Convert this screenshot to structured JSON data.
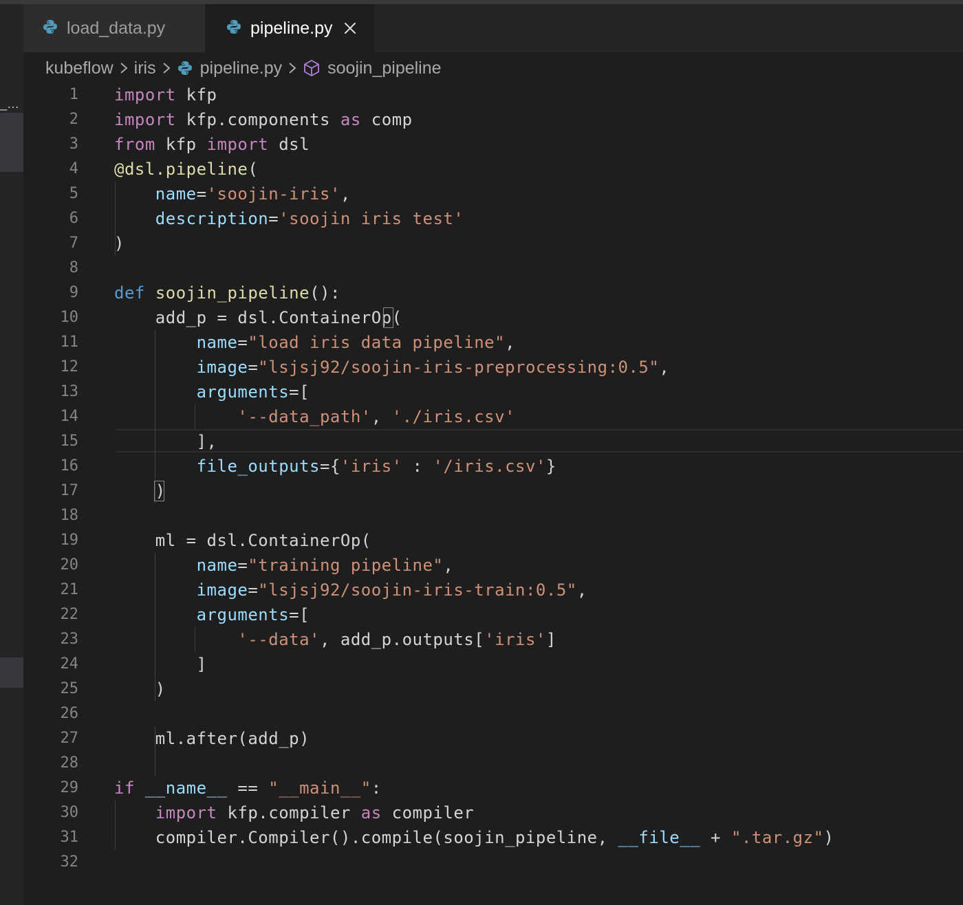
{
  "tabs": [
    {
      "label": "load_data.py",
      "active": false,
      "icon": "python-icon"
    },
    {
      "label": "pipeline.py",
      "active": true,
      "icon": "python-icon"
    }
  ],
  "breadcrumb": {
    "segments": [
      "kubeflow",
      "iris",
      "pipeline.py",
      "soojin_pipeline"
    ]
  },
  "sidebar_fragment_text": "_…",
  "editor": {
    "current_line": 15,
    "lines": [
      {
        "n": "1",
        "tokens": [
          {
            "t": "kw",
            "v": "import"
          },
          {
            "t": "op",
            "v": " kfp"
          }
        ]
      },
      {
        "n": "2",
        "tokens": [
          {
            "t": "kw",
            "v": "import"
          },
          {
            "t": "op",
            "v": " kfp.components "
          },
          {
            "t": "kw",
            "v": "as"
          },
          {
            "t": "op",
            "v": " comp"
          }
        ]
      },
      {
        "n": "3",
        "tokens": [
          {
            "t": "kw",
            "v": "from"
          },
          {
            "t": "op",
            "v": " kfp "
          },
          {
            "t": "kw",
            "v": "import"
          },
          {
            "t": "op",
            "v": " dsl"
          }
        ]
      },
      {
        "n": "4",
        "tokens": [
          {
            "t": "dec",
            "v": "@dsl.pipeline"
          },
          {
            "t": "op",
            "v": "("
          }
        ]
      },
      {
        "n": "5",
        "tokens": [
          {
            "t": "op",
            "v": "    "
          },
          {
            "t": "prm",
            "v": "name"
          },
          {
            "t": "op",
            "v": "="
          },
          {
            "t": "str",
            "v": "'soojin-iris'"
          },
          {
            "t": "op",
            "v": ","
          }
        ]
      },
      {
        "n": "6",
        "tokens": [
          {
            "t": "op",
            "v": "    "
          },
          {
            "t": "prm",
            "v": "description"
          },
          {
            "t": "op",
            "v": "="
          },
          {
            "t": "str",
            "v": "'soojin iris test'"
          }
        ]
      },
      {
        "n": "7",
        "tokens": [
          {
            "t": "op",
            "v": ")"
          }
        ]
      },
      {
        "n": "8",
        "tokens": []
      },
      {
        "n": "9",
        "tokens": [
          {
            "t": "kwb",
            "v": "def"
          },
          {
            "t": "op",
            "v": " "
          },
          {
            "t": "fn",
            "v": "soojin_pipeline"
          },
          {
            "t": "op",
            "v": "():"
          }
        ]
      },
      {
        "n": "10",
        "tokens": [
          {
            "t": "op",
            "v": "    add_p = dsl.ContainerOp("
          }
        ]
      },
      {
        "n": "11",
        "tokens": [
          {
            "t": "op",
            "v": "        "
          },
          {
            "t": "prm",
            "v": "name"
          },
          {
            "t": "op",
            "v": "="
          },
          {
            "t": "str",
            "v": "\"load iris data pipeline\""
          },
          {
            "t": "op",
            "v": ","
          }
        ]
      },
      {
        "n": "12",
        "tokens": [
          {
            "t": "op",
            "v": "        "
          },
          {
            "t": "prm",
            "v": "image"
          },
          {
            "t": "op",
            "v": "="
          },
          {
            "t": "str",
            "v": "\"lsjsj92/soojin-iris-preprocessing:0.5\""
          },
          {
            "t": "op",
            "v": ","
          }
        ]
      },
      {
        "n": "13",
        "tokens": [
          {
            "t": "op",
            "v": "        "
          },
          {
            "t": "prm",
            "v": "arguments"
          },
          {
            "t": "op",
            "v": "=["
          }
        ]
      },
      {
        "n": "14",
        "tokens": [
          {
            "t": "op",
            "v": "            "
          },
          {
            "t": "str",
            "v": "'--data_path'"
          },
          {
            "t": "op",
            "v": ", "
          },
          {
            "t": "str",
            "v": "'./iris.csv'"
          }
        ]
      },
      {
        "n": "15",
        "tokens": [
          {
            "t": "op",
            "v": "        ],"
          }
        ]
      },
      {
        "n": "16",
        "tokens": [
          {
            "t": "op",
            "v": "        "
          },
          {
            "t": "prm",
            "v": "file_outputs"
          },
          {
            "t": "op",
            "v": "={"
          },
          {
            "t": "str",
            "v": "'iris'"
          },
          {
            "t": "op",
            "v": " : "
          },
          {
            "t": "str",
            "v": "'/iris.csv'"
          },
          {
            "t": "op",
            "v": "}"
          }
        ]
      },
      {
        "n": "17",
        "tokens": [
          {
            "t": "op",
            "v": "    )"
          }
        ]
      },
      {
        "n": "18",
        "tokens": []
      },
      {
        "n": "19",
        "tokens": [
          {
            "t": "op",
            "v": "    ml = dsl.ContainerOp("
          }
        ]
      },
      {
        "n": "20",
        "tokens": [
          {
            "t": "op",
            "v": "        "
          },
          {
            "t": "prm",
            "v": "name"
          },
          {
            "t": "op",
            "v": "="
          },
          {
            "t": "str",
            "v": "\"training pipeline\""
          },
          {
            "t": "op",
            "v": ","
          }
        ]
      },
      {
        "n": "21",
        "tokens": [
          {
            "t": "op",
            "v": "        "
          },
          {
            "t": "prm",
            "v": "image"
          },
          {
            "t": "op",
            "v": "="
          },
          {
            "t": "str",
            "v": "\"lsjsj92/soojin-iris-train:0.5\""
          },
          {
            "t": "op",
            "v": ","
          }
        ]
      },
      {
        "n": "22",
        "tokens": [
          {
            "t": "op",
            "v": "        "
          },
          {
            "t": "prm",
            "v": "arguments"
          },
          {
            "t": "op",
            "v": "=["
          }
        ]
      },
      {
        "n": "23",
        "tokens": [
          {
            "t": "op",
            "v": "            "
          },
          {
            "t": "str",
            "v": "'--data'"
          },
          {
            "t": "op",
            "v": ", add_p.outputs["
          },
          {
            "t": "str",
            "v": "'iris'"
          },
          {
            "t": "op",
            "v": "]"
          }
        ]
      },
      {
        "n": "24",
        "tokens": [
          {
            "t": "op",
            "v": "        ]"
          }
        ]
      },
      {
        "n": "25",
        "tokens": [
          {
            "t": "op",
            "v": "    )"
          }
        ]
      },
      {
        "n": "26",
        "tokens": []
      },
      {
        "n": "27",
        "tokens": [
          {
            "t": "op",
            "v": "    ml.after(add_p)"
          }
        ]
      },
      {
        "n": "28",
        "tokens": []
      },
      {
        "n": "29",
        "tokens": [
          {
            "t": "kw",
            "v": "if"
          },
          {
            "t": "op",
            "v": " "
          },
          {
            "t": "prm",
            "v": "__name__"
          },
          {
            "t": "op",
            "v": " == "
          },
          {
            "t": "str",
            "v": "\"__main__\""
          },
          {
            "t": "op",
            "v": ":"
          }
        ]
      },
      {
        "n": "30",
        "tokens": [
          {
            "t": "op",
            "v": "    "
          },
          {
            "t": "kw",
            "v": "import"
          },
          {
            "t": "op",
            "v": " kfp.compiler "
          },
          {
            "t": "kw",
            "v": "as"
          },
          {
            "t": "op",
            "v": " compiler"
          }
        ]
      },
      {
        "n": "31",
        "tokens": [
          {
            "t": "op",
            "v": "    compiler.Compiler().compile(soojin_pipeline, "
          },
          {
            "t": "prm",
            "v": "__file__"
          },
          {
            "t": "op",
            "v": " + "
          },
          {
            "t": "str",
            "v": "\".tar.gz\""
          },
          {
            "t": "op",
            "v": ")"
          }
        ]
      },
      {
        "n": "32",
        "tokens": []
      }
    ]
  }
}
